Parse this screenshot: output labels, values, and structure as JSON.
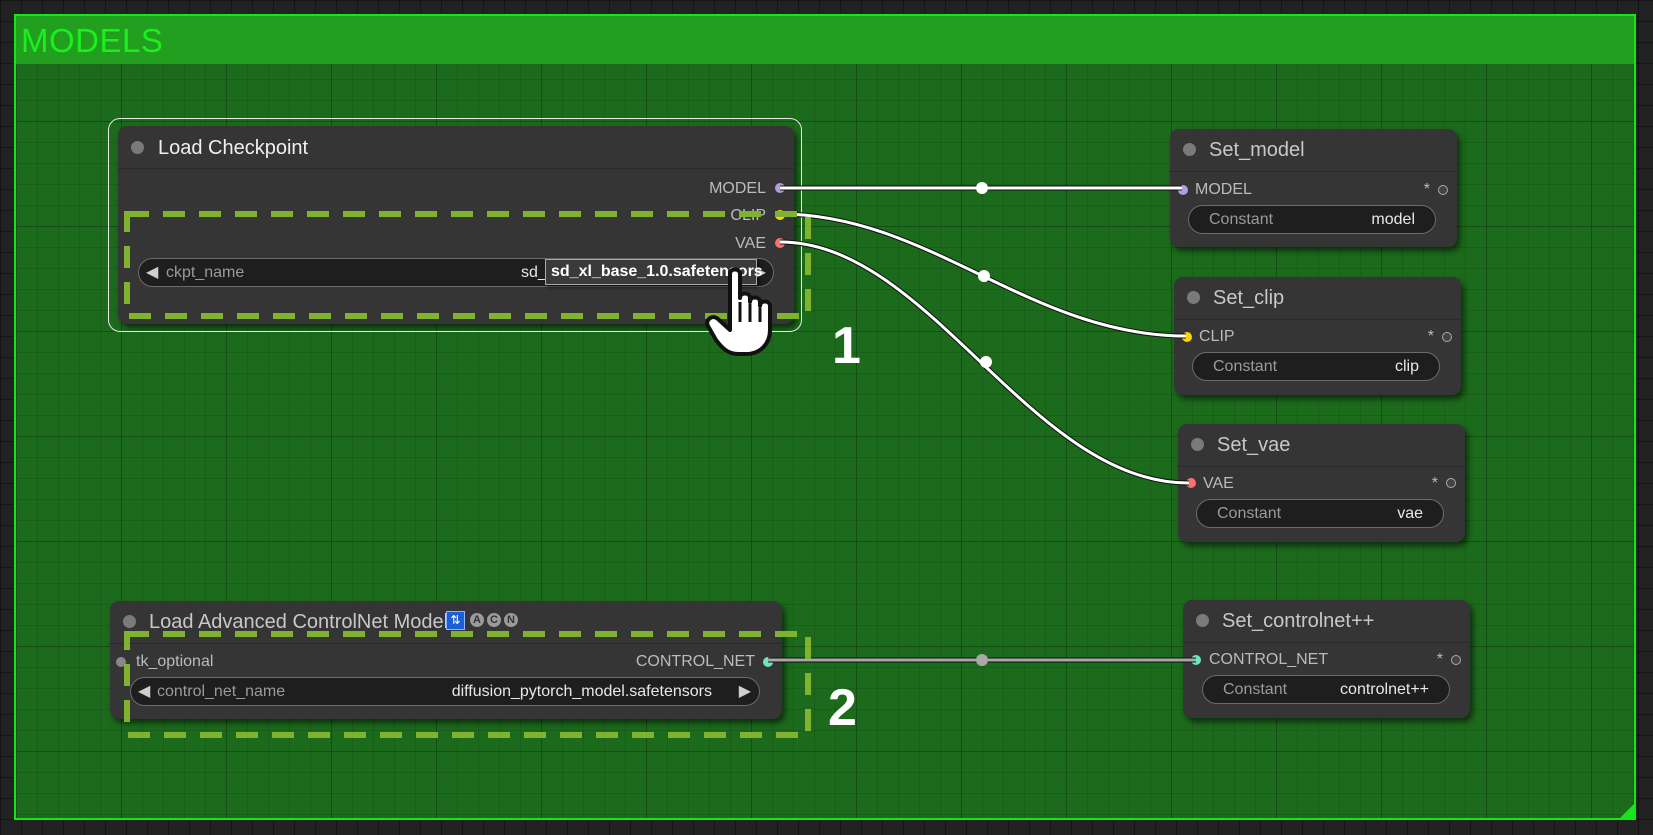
{
  "group": {
    "title": "MODELS",
    "color": "#1c6a1c",
    "border_color": "#18e41a"
  },
  "nodes": {
    "load_checkpoint": {
      "title": "Load Checkpoint",
      "outputs": [
        "MODEL",
        "CLIP",
        "VAE"
      ],
      "widget": {
        "name": "ckpt_name",
        "value": "sd_"
      },
      "tooltip": "sd_xl_base_1.0.safetensors"
    },
    "load_controlnet": {
      "title": "Load Advanced ControlNet Model",
      "badges": [
        "A",
        "C",
        "N"
      ],
      "input": "tk_optional",
      "output": "CONTROL_NET",
      "widget": {
        "name": "control_net_name",
        "value": "diffusion_pytorch_model.safetensors"
      }
    },
    "set_model": {
      "title": "Set_model",
      "input": "MODEL",
      "star": "*",
      "widget": {
        "name": "Constant",
        "value": "model"
      }
    },
    "set_clip": {
      "title": "Set_clip",
      "input": "CLIP",
      "star": "*",
      "widget": {
        "name": "Constant",
        "value": "clip"
      }
    },
    "set_vae": {
      "title": "Set_vae",
      "input": "VAE",
      "star": "*",
      "widget": {
        "name": "Constant",
        "value": "vae"
      }
    },
    "set_controlnet": {
      "title": "Set_controlnet++",
      "input": "CONTROL_NET",
      "star": "*",
      "widget": {
        "name": "Constant",
        "value": "controlnet++"
      }
    }
  },
  "annotations": [
    "1",
    "2"
  ],
  "colors": {
    "model_slot": "#b39ddb",
    "clip_slot": "#ffd500",
    "vae_slot": "#ff6e6e",
    "controlnet_slot": "#6ee7b7",
    "highlight_dash": "#7fb22f"
  }
}
